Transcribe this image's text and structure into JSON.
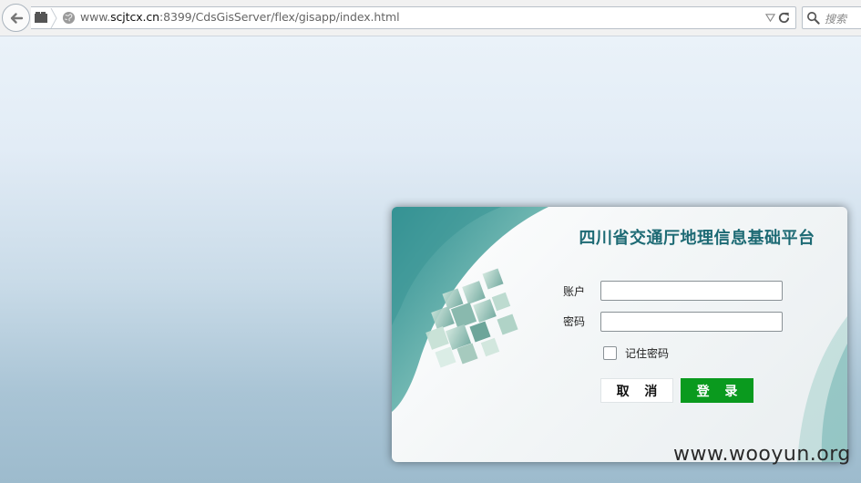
{
  "browser": {
    "url_prefix": "www.",
    "url_host": "scjtcx.cn",
    "url_rest": ":8399/CdsGisServer/flex/gisapp/index.html",
    "search_placeholder": "搜索"
  },
  "login": {
    "title": "四川省交通厅地理信息基础平台",
    "username_label": "账户",
    "password_label": "密码",
    "username_value": "",
    "password_value": "",
    "remember_label": "记住密码",
    "remember_checked": false,
    "cancel_label": "取 消",
    "login_label": "登 录"
  },
  "watermark": "www.wooyun.org",
  "colors": {
    "title": "#1d6a74",
    "login_button": "#0a9a1e",
    "accent_teal": "#3e9a99"
  }
}
